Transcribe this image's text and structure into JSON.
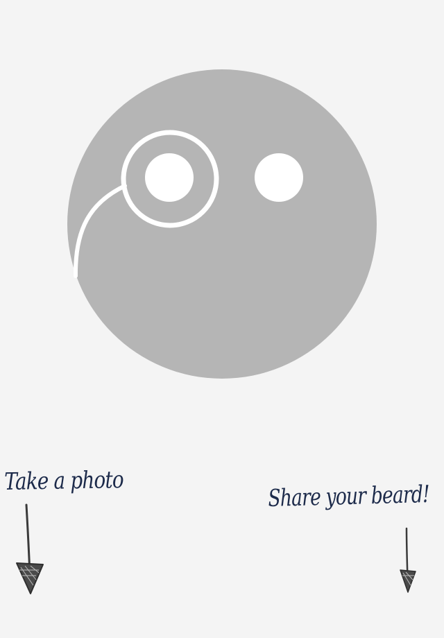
{
  "illustration": {
    "face_color": "#b5b5b5",
    "eye_color": "#ffffff",
    "monocle_color": "#ffffff",
    "icon": "monocle-face-icon"
  },
  "hints": {
    "take_photo": "Take a photo",
    "share_beard": "Share your beard!"
  },
  "colors": {
    "background": "#f4f4f4",
    "handwriting": "#1c2a4a",
    "arrow": "#3a3a3a"
  }
}
